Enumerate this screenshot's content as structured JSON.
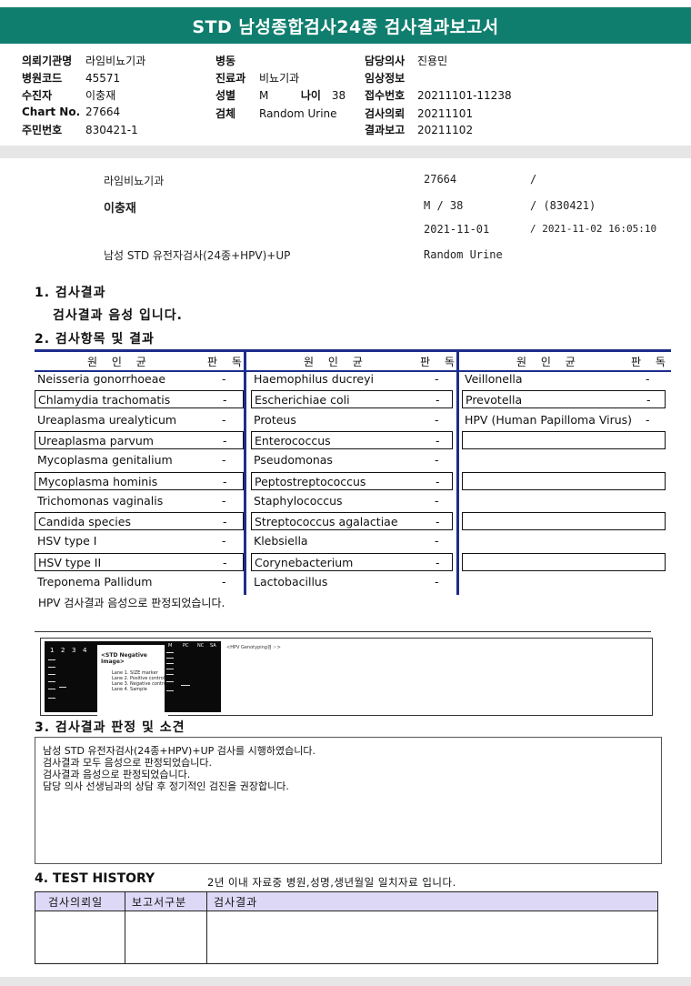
{
  "report": {
    "title": "STD 남성종합검사24종 검사결과보고서"
  },
  "header": {
    "institution_label": "의뢰기관명",
    "institution": "라임비뇨기과",
    "hospital_code_label": "병원코드",
    "hospital_code": "45571",
    "recipient_label": "수진자",
    "recipient": "이충재",
    "chart_label": "Chart No.",
    "chart_no": "27664",
    "rrn_label": "주민번호",
    "rrn": "830421-1",
    "ward_label": "병동",
    "ward": "",
    "dept_label": "진료과",
    "dept": "비뇨기과",
    "sex_label": "성별",
    "sex": "M",
    "age_label": "나이",
    "age": "38",
    "specimen_label": "검체",
    "specimen": "Random Urine",
    "doctor_label": "담당의사",
    "doctor": "진용민",
    "clinical_label": "임상정보",
    "clinical": "",
    "accession_label": "접수번호",
    "accession": "20211101-11238",
    "request_label": "검사의뢰",
    "request_date": "20211101",
    "report_label": "결과보고",
    "report_date": "20211102"
  },
  "patient": {
    "clinic": "라임비뇨기과",
    "name": "이충재",
    "test_name": "남성 STD 유전자검사(24종+HPV)+UP",
    "chart": "27664",
    "slash1": "/",
    "sex_age": "M  /  38",
    "rrn_paren": "/ (830421)",
    "date_request": "2021-11-01",
    "date_report": "/ 2021-11-02 16:05:10",
    "specimen": "Random Urine"
  },
  "section1": {
    "title": "1. 검사결과",
    "result": "검사결과 음성 입니다."
  },
  "section2": {
    "title": "2. 검사항목 및 결과",
    "col_pathogen": "원 인 균",
    "col_result": "판 독",
    "col1": [
      {
        "name": "Neisseria gonorrhoeae",
        "result": "-"
      },
      {
        "name": "Chlamydia trachomatis",
        "result": "-"
      },
      {
        "name": "Ureaplasma urealyticum",
        "result": "-"
      },
      {
        "name": "Ureaplasma parvum",
        "result": "-"
      },
      {
        "name": "Mycoplasma genitalium",
        "result": "-"
      },
      {
        "name": "Mycoplasma hominis",
        "result": "-"
      },
      {
        "name": "Trichomonas vaginalis",
        "result": "-"
      },
      {
        "name": "Candida species",
        "result": "-"
      },
      {
        "name": "HSV type I",
        "result": "-"
      },
      {
        "name": "HSV type II",
        "result": "-"
      },
      {
        "name": "Treponema Pallidum",
        "result": "-"
      }
    ],
    "col2": [
      {
        "name": "Haemophilus ducreyi",
        "result": "-"
      },
      {
        "name": "Escherichiae coli",
        "result": "-"
      },
      {
        "name": "Proteus",
        "result": "-"
      },
      {
        "name": "Enterococcus",
        "result": "-"
      },
      {
        "name": "Pseudomonas",
        "result": "-"
      },
      {
        "name": "Peptostreptococcus",
        "result": "-"
      },
      {
        "name": "Staphylococcus",
        "result": "-"
      },
      {
        "name": "Streptococcus agalactiae",
        "result": "-"
      },
      {
        "name": "Klebsiella",
        "result": "-"
      },
      {
        "name": "Corynebacterium",
        "result": "-"
      },
      {
        "name": "Lactobacillus",
        "result": "-"
      }
    ],
    "col3": [
      {
        "name": "Veillonella",
        "result": "-"
      },
      {
        "name": "Prevotella",
        "result": "-"
      },
      {
        "name": "HPV (Human Papilloma Virus)",
        "result": "-"
      },
      {
        "name": "",
        "result": ""
      },
      {
        "name": "",
        "result": ""
      },
      {
        "name": "",
        "result": ""
      },
      {
        "name": "",
        "result": ""
      },
      {
        "name": "",
        "result": ""
      },
      {
        "name": "",
        "result": ""
      },
      {
        "name": "",
        "result": ""
      },
      {
        "name": "",
        "result": ""
      }
    ],
    "hpv_note": "HPV 검사결과 음성으로 판정되었습니다."
  },
  "gel_image": {
    "lanes": [
      "1",
      "2",
      "3",
      "4"
    ],
    "legend_title": "<STD Negative Image>",
    "legend_lines": [
      "Lane 1. SIZE marker",
      "Lane 2. Positive control",
      "Lane 3. Negative control",
      "Lane 4. Sample"
    ],
    "genotype_label": "<HPV Genotyping검 ☞>",
    "gel2_lanes": [
      "M",
      "PC",
      "NC",
      "SA"
    ]
  },
  "section3": {
    "title": "3. 검사결과 판정 및 소견",
    "lines": [
      "남성 STD 유전자검사(24종+HPV)+UP 검사를 시행하였습니다.",
      "검사결과 모두 음성으로 판정되었습니다.",
      "검사결과 음성으로 판정되었습니다.",
      "담당 의사 선생님과의 상담 후 정기적인 검진을 권장합니다."
    ]
  },
  "section4": {
    "title": "4. TEST HISTORY",
    "note": "2년 이내 자료중 병원,성명,생년월일 일치자료 입니다.",
    "col_date": "검사의뢰일",
    "col_type": "보고서구분",
    "col_result": "검사결과"
  }
}
